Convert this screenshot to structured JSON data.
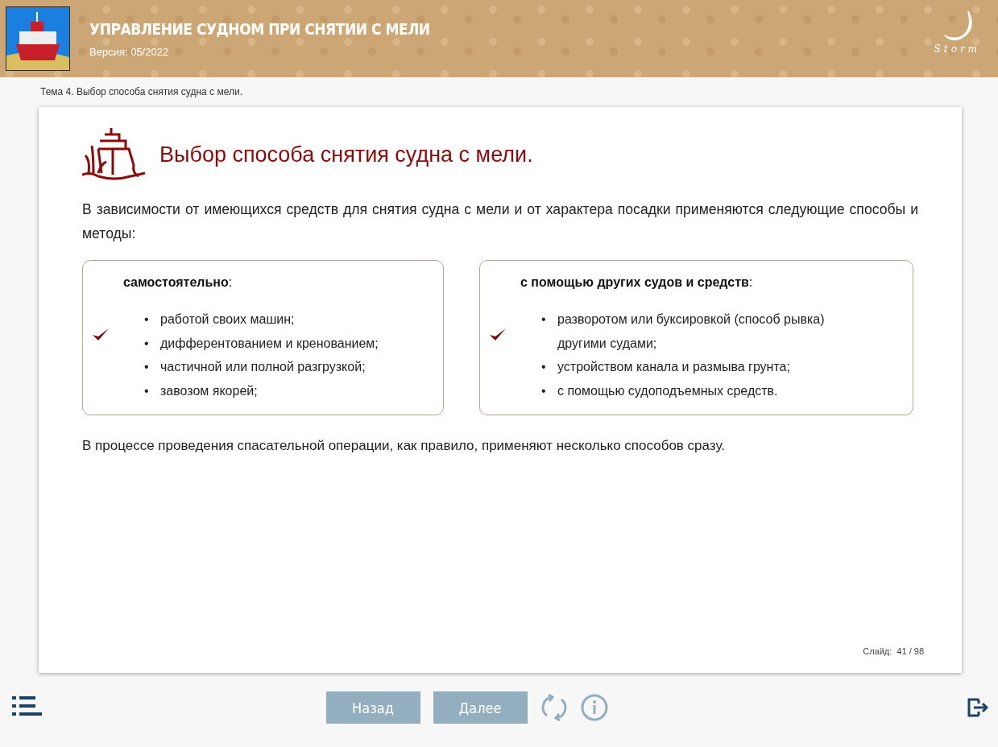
{
  "header": {
    "title": "УПРАВЛЕНИЕ СУДНОМ ПРИ СНЯТИИ С МЕЛИ",
    "version": "Версия: 05/2022",
    "logo_text": "Storm"
  },
  "breadcrumb": "Тема 4. Выбор способа снятия судна с мели.",
  "slide": {
    "title": "Выбор способа снятия судна с мели.",
    "intro": "В зависимости от имеющихся средств для снятия судна с мели и от характера посадки применяются следующие способы и методы:",
    "boxes": [
      {
        "heading": "**самостоятельно**:",
        "items": [
          {
            "bullet": "•",
            "text": "работой своих машин;"
          },
          {
            "bullet": "•",
            "text": "дифферентованием и кренованием;"
          },
          {
            "bullet": "•",
            "text": "частичной или полной разгрузкой;"
          },
          {
            "bullet": "•",
            "text": "завозом якорей;"
          }
        ]
      },
      {
        "heading": "**с помощью других судов и средств**:",
        "items": [
          {
            "bullet": "•",
            "text": "разворотом или буксировкой (способ рывка) другими судами;"
          },
          {
            "bullet": "•",
            "text": "устройством канала и размыва грунта;"
          },
          {
            "bullet": "•",
            "text": "с помощью судоподъемных средств."
          }
        ]
      }
    ],
    "conclusion": "В процессе проведения спасательной операции, как правило, применяют несколько способов сразу.",
    "counter_label": "Слайд:",
    "counter": "41 / 98"
  },
  "footer": {
    "buttons": [
      "Назад",
      "Далее"
    ]
  }
}
